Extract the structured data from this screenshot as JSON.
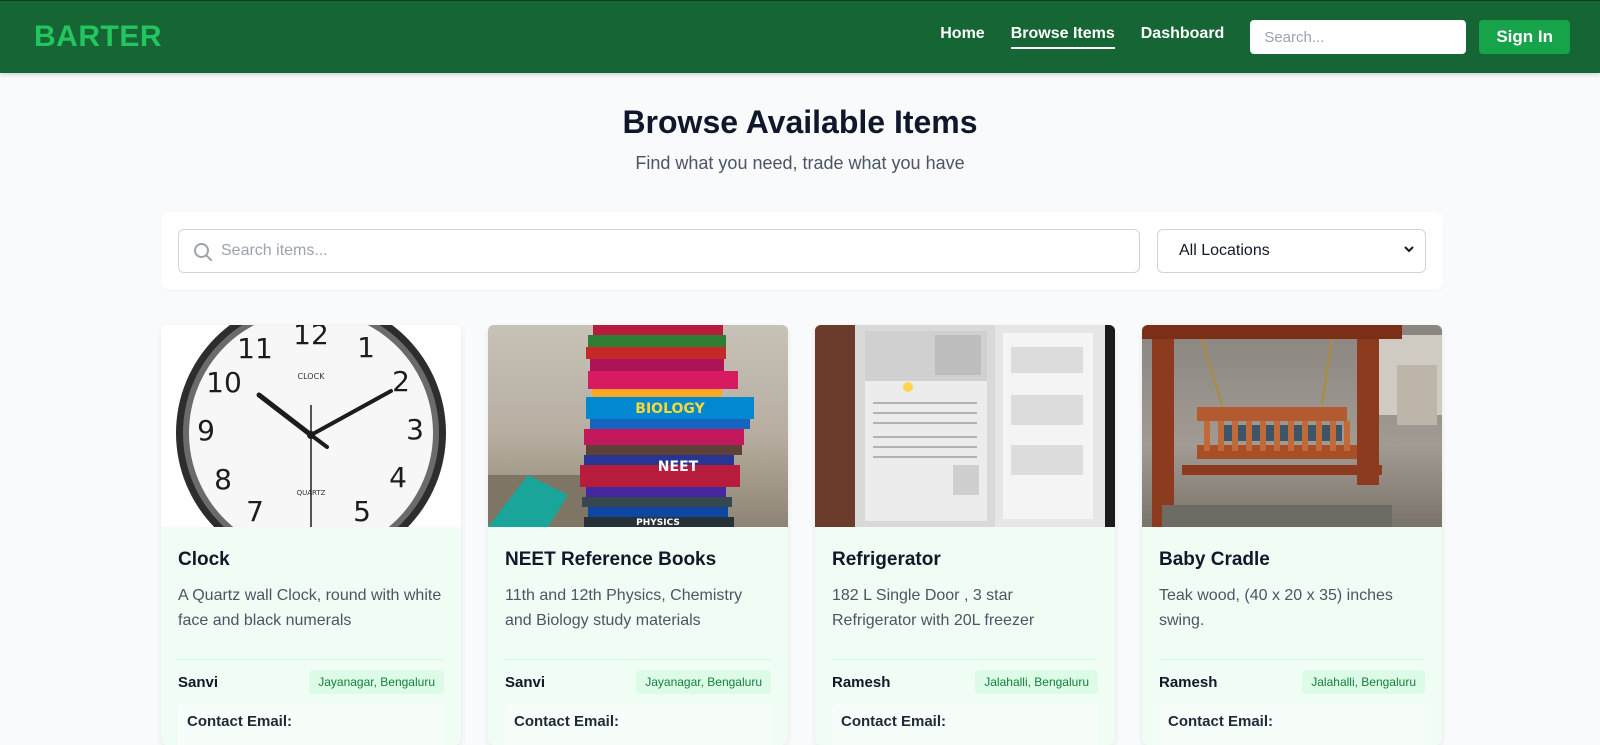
{
  "nav": {
    "logo": "BARTER",
    "links": [
      "Home",
      "Browse Items",
      "Dashboard"
    ],
    "active_link": "Browse Items",
    "search_placeholder": "Search...",
    "signin_label": "Sign In"
  },
  "hero": {
    "title": "Browse Available Items",
    "subtitle": "Find what you need, trade what you have"
  },
  "filters": {
    "search_placeholder": "Search items...",
    "location_selected": "All Locations"
  },
  "items": [
    {
      "title": "Clock",
      "description": "A Quartz wall Clock, round with white face and black numerals",
      "owner": "Sanvi",
      "location": "Jayanagar, Bengaluru",
      "contact_label": "Contact Email:",
      "image_icon": "clock-photo"
    },
    {
      "title": "NEET Reference Books",
      "description": "11th and 12th Physics, Chemistry and Biology study materials",
      "owner": "Sanvi",
      "location": "Jayanagar, Bengaluru",
      "contact_label": "Contact Email:",
      "image_icon": "books-photo",
      "image_text": [
        "NEET",
        "BIOLOGY",
        "PHYSICS"
      ]
    },
    {
      "title": "Refrigerator",
      "description": "182 L Single Door , 3 star Refrigerator with 20L freezer",
      "owner": "Ramesh",
      "location": "Jalahalli, Bengaluru",
      "contact_label": "Contact Email:",
      "image_icon": "refrigerator-photo"
    },
    {
      "title": "Baby Cradle",
      "description": "Teak wood, (40 x 20 x 35) inches swing.",
      "owner": "Ramesh",
      "location": "Jalahalli, Bengaluru",
      "contact_label": "Contact Email:",
      "image_icon": "cradle-photo"
    }
  ],
  "colors": {
    "nav_bg": "#166534",
    "logo": "#22c55e",
    "signin_bg": "#16a34a",
    "card_bg": "#f0fdf4",
    "badge_bg": "#dcfce7",
    "badge_text": "#15803d"
  }
}
